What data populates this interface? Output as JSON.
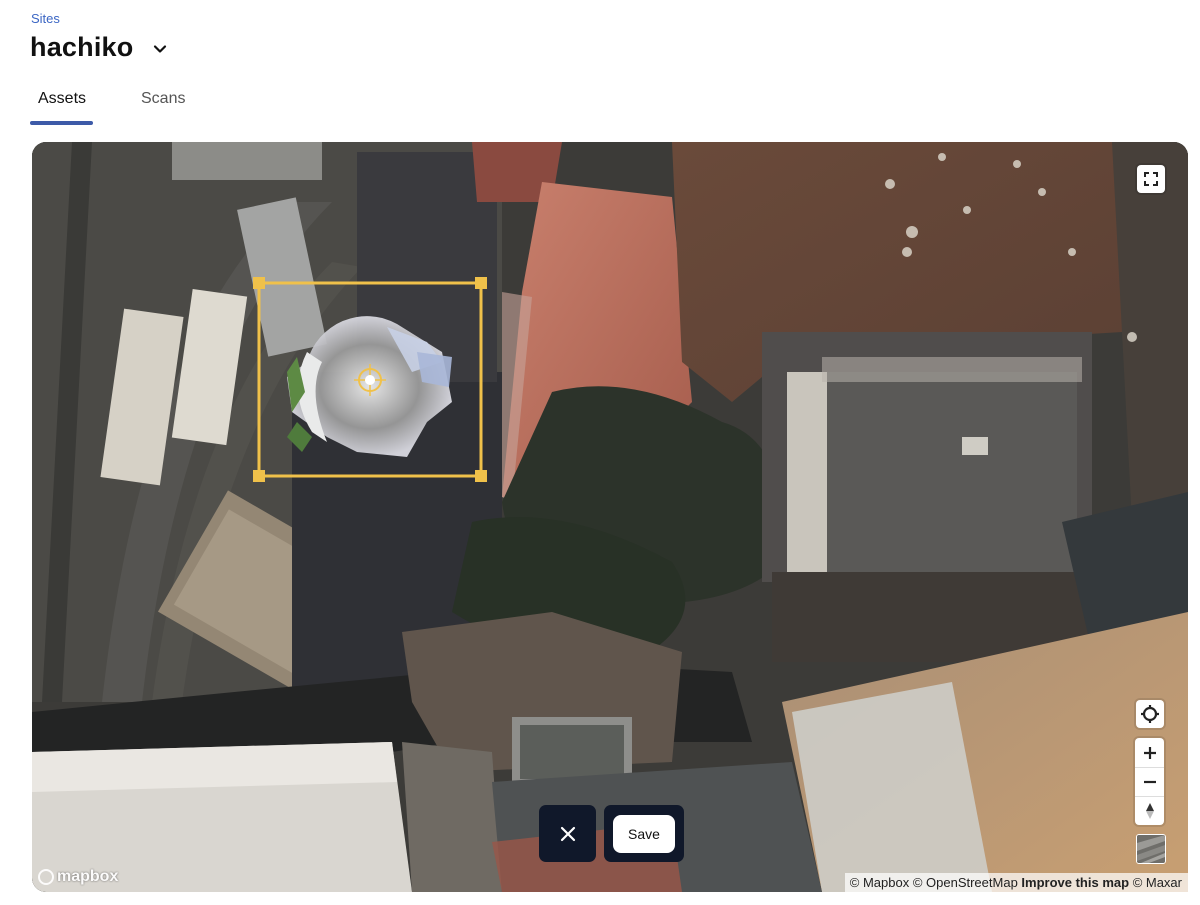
{
  "header": {
    "breadcrumb": "Sites",
    "site_name": "hachiko"
  },
  "tabs": [
    {
      "label": "Assets",
      "active": true
    },
    {
      "label": "Scans",
      "active": false
    }
  ],
  "map": {
    "controls": {
      "fullscreen_icon": "fullscreen-icon",
      "geolocate_icon": "geolocate-icon",
      "zoom_in_icon": "plus-icon",
      "zoom_out_icon": "minus-icon",
      "compass_icon": "compass-icon"
    },
    "logo": "mapbox",
    "attribution": {
      "mapbox": "© Mapbox",
      "osm": "© OpenStreetMap",
      "improve": "Improve this map",
      "maxar": "© Maxar"
    },
    "selection_color": "#f0c14a"
  },
  "actions": {
    "cancel_icon": "close-icon",
    "save_label": "Save"
  },
  "colors": {
    "accent": "#3d5aa8",
    "link": "#3b66c4",
    "action_bar": "#10182a"
  }
}
